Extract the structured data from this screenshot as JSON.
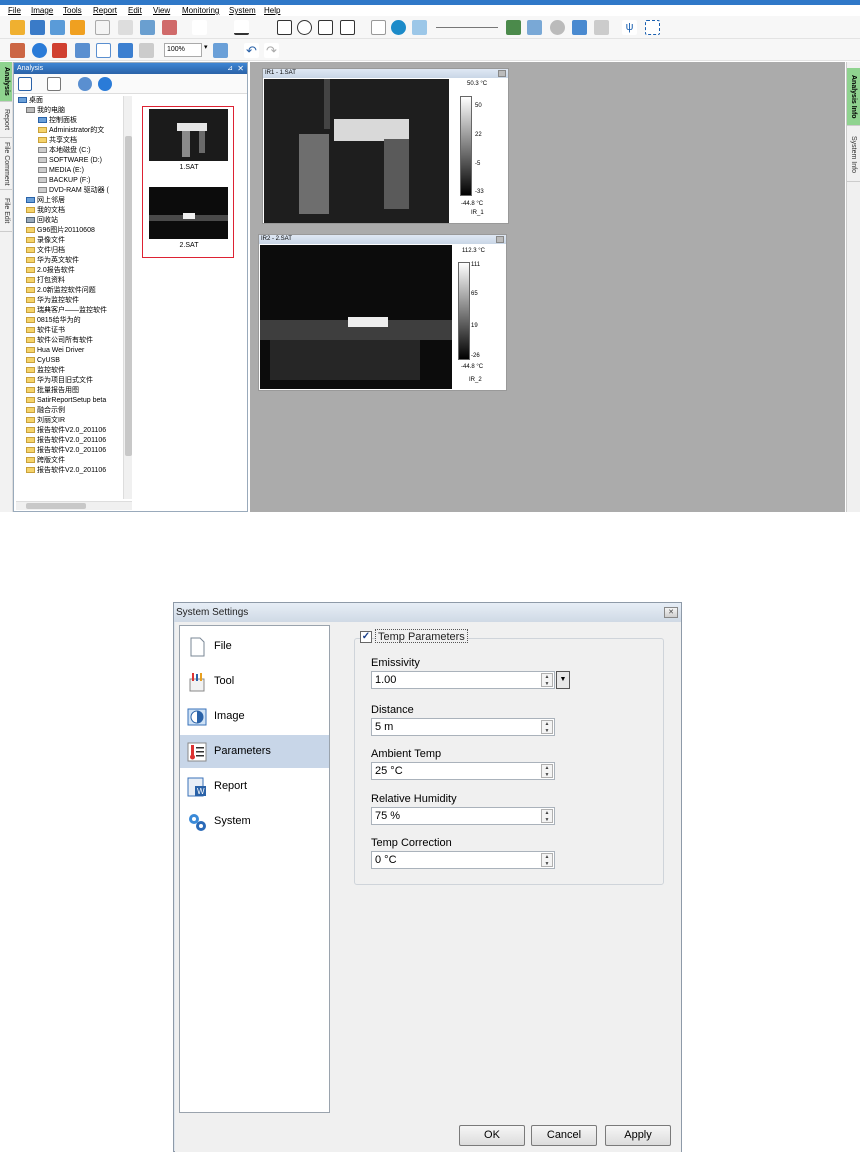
{
  "menu": [
    "File",
    "Image",
    "Tools",
    "Report",
    "Edit",
    "View",
    "Monitoring",
    "System",
    "Help"
  ],
  "toolbar": {
    "zoom": "100%"
  },
  "left_tabs": [
    "Analysis",
    "Report",
    "File Comment",
    "File Edit"
  ],
  "panel": {
    "title": "Analysis"
  },
  "tree": [
    "桌面",
    "我的电脑",
    "控制面板",
    "Administrator的文",
    "共享文档",
    "本地磁盘 (C:)",
    "SOFTWARE (D:)",
    "MEDIA (E:)",
    "BACKUP (F:)",
    "DVD-RAM 驱动器 (",
    "网上邻居",
    "我的文档",
    "回收站",
    "G96图片20110608",
    "录像文件",
    "文件归档",
    "华为英文软件",
    "2.0报告软件",
    "打包资料",
    "2.0新监控软件问题",
    "华为监控软件",
    "瑞典客户——监控软件",
    "0815给华为的",
    "软件证书",
    "软件公司所有软件",
    "Hua Wei Driver",
    "CyUSB",
    "监控软件",
    "华为项目旧式文件",
    "批量报告用图",
    "SatirReportSetup beta",
    "融合示例",
    "刘丽文IR",
    "报告软件V2.0_201106",
    "报告软件V2.0_201106",
    "报告软件V2.0_201106",
    "跨版文件",
    "报告软件V2.0_201106"
  ],
  "thumbnails": [
    "1.SAT",
    "2.SAT"
  ],
  "ir1": {
    "title": "IR1 - 1.SAT",
    "max": "50.3 °C",
    "ticks": [
      "50",
      "22",
      "-5",
      "-33"
    ],
    "min": "-44.8 °C",
    "name": "IR_1"
  },
  "ir2": {
    "title": "IR2 - 2.SAT",
    "max": "112.3 °C",
    "ticks": [
      "111",
      "65",
      "19",
      "-26"
    ],
    "min": "-44.8 °C",
    "name": "IR_2"
  },
  "right_tabs": [
    "Analysis Info",
    "System Info"
  ],
  "dialog": {
    "title": "System Settings",
    "nav": [
      "File",
      "Tool",
      "Image",
      "Parameters",
      "Report",
      "System"
    ],
    "selected": "Parameters",
    "group_label": "Temp Parameters",
    "group_checked": true,
    "fields": [
      {
        "label": "Emissivity",
        "value": "1.00"
      },
      {
        "label": "Distance",
        "value": "5 m"
      },
      {
        "label": "Ambient Temp",
        "value": "25 °C"
      },
      {
        "label": "Relative Humidity",
        "value": "75 %"
      },
      {
        "label": "Temp Correction",
        "value": "0 °C"
      }
    ],
    "buttons": {
      "ok": "OK",
      "cancel": "Cancel",
      "apply": "Apply"
    }
  },
  "colors": {
    "title_blue": "#2f78c8",
    "active_tab_green": "#8fd38f",
    "selection": "#c8d6e8"
  }
}
